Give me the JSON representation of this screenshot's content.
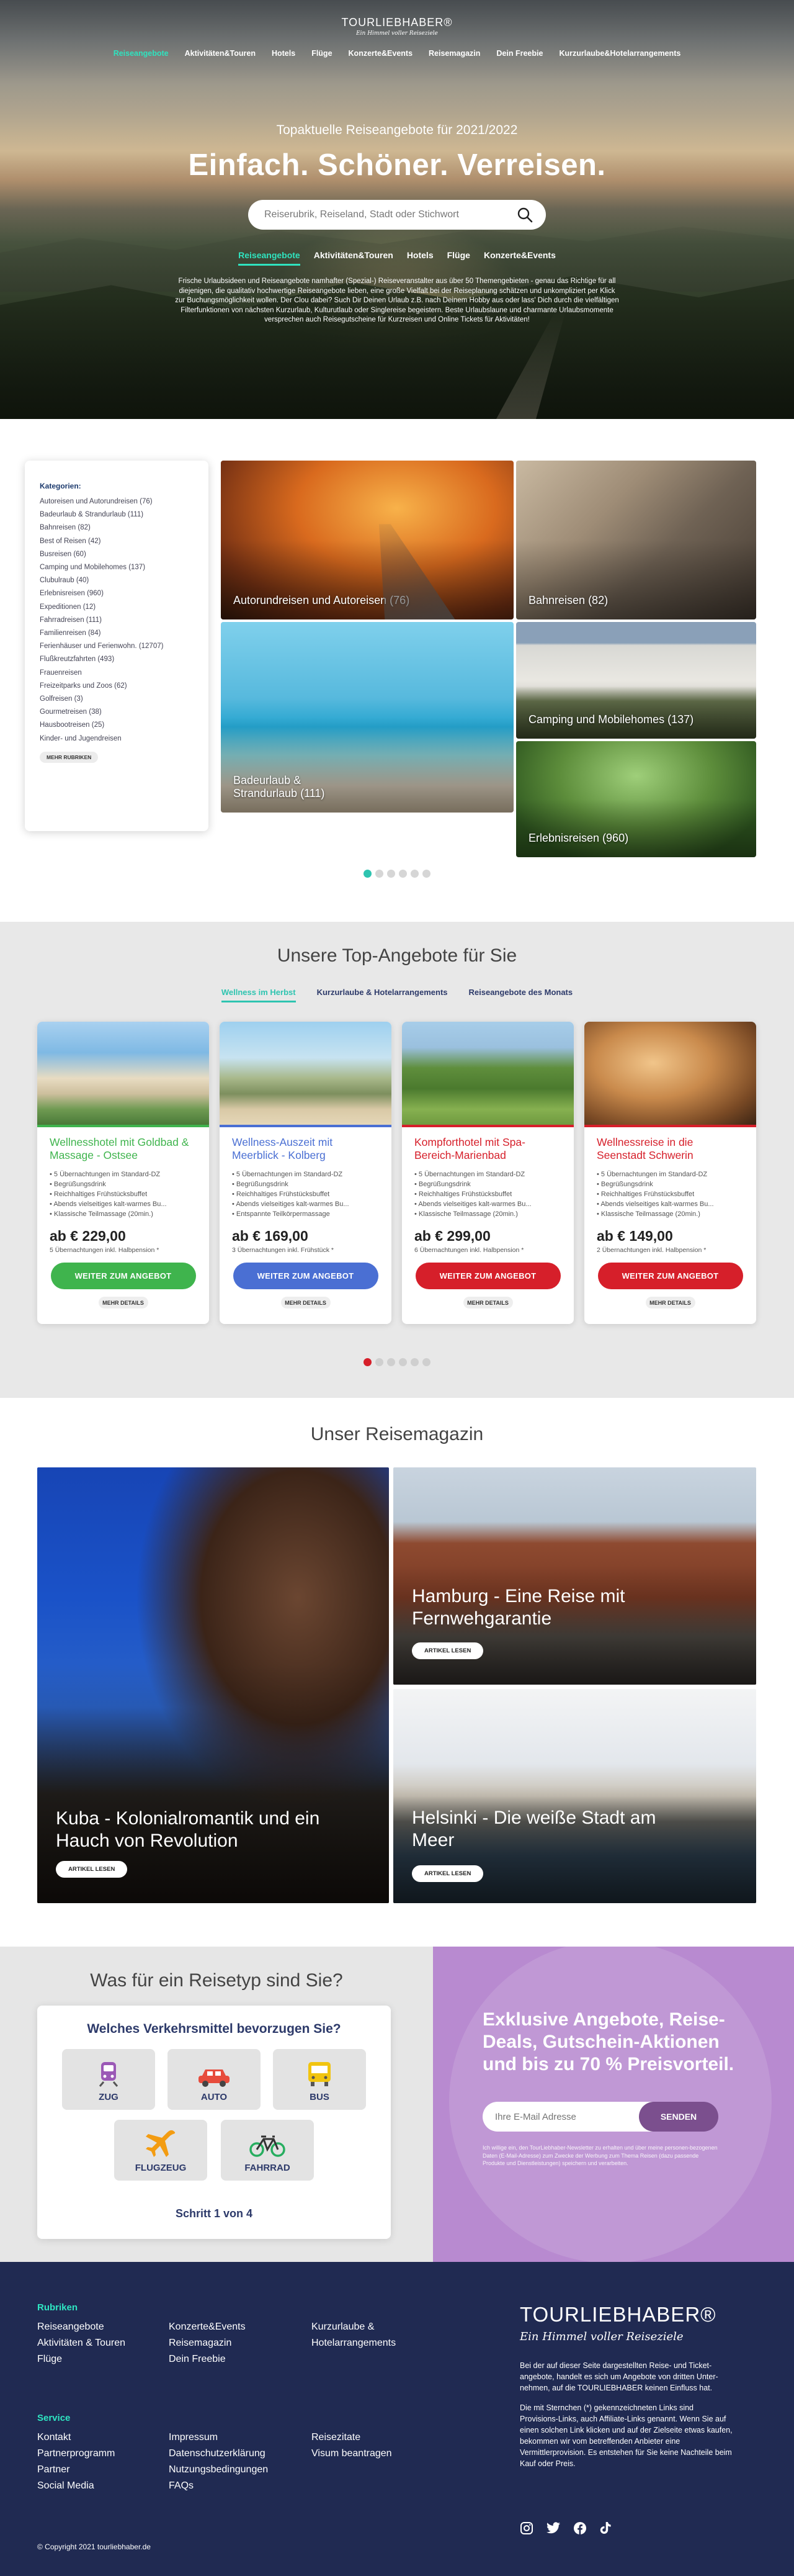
{
  "brand": {
    "name_bold": "TOUR",
    "name_light": "LIEBHABER",
    "reg": "®",
    "slogan": "Ein Himmel voller Reiseziele"
  },
  "topnav": [
    "Reiseangebote",
    "Aktivitäten&Touren",
    "Hotels",
    "Flüge",
    "Konzerte&Events",
    "Reisemagazin",
    "Dein Freebie",
    "Kurzurlaube&Hotelarrangements"
  ],
  "hero": {
    "subtitle": "Topaktuelle Reiseangebote für 2021/2022",
    "title": "Einfach. Schöner. Verreisen.",
    "search_placeholder": "Reiserubrik, Reiseland, Stadt oder Stichwort",
    "nav": [
      "Reiseangebote",
      "Aktivitäten&Touren",
      "Hotels",
      "Flüge",
      "Konzerte&Events"
    ],
    "text": "Frische Urlaubsideen und Reiseangebote namhafter (Spezial-) Reiseveranstalter aus über 50 Themengebieten - genau das Richtige für all diejenigen, die qualitativ hochwertige Reiseangebote lieben, eine große Vielfalt bei der Reiseplanung schätzen und unkompliziert per Klick zur Buchungsmöglichkeit wollen. Der Clou dabei? Such Dir Deinen Urlaub z.B. nach Deinem Hobby aus oder lass' Dich durch die vielfältigen Filterfunktionen von nächsten Kurzurlaub, Kulturutlaub oder Singlereise begeistern. Beste Urlaubslaune und charmante Urlaubsmomente versprechen auch Reisegutscheine für Kurzreisen und Online Tickets für Aktivitäten!"
  },
  "categories": {
    "heading": "Kategorien:",
    "items": [
      "Autoreisen und Autorundreisen (76)",
      "Badeurlaub & Strandurlaub (111)",
      "Bahnreisen (82)",
      "Best of Reisen (42)",
      "Busreisen (60)",
      "Camping und Mobilehomes (137)",
      "Clubulraub (40)",
      "Erlebnisreisen (960)",
      "Expeditionen (12)",
      "Fahrradreisen (111)",
      "Familienreisen (84)",
      "Ferienhäuser und Ferienwohn. (12707)",
      "Flußkreutzfahrten (493)",
      "Frauenreisen",
      "Freizeitparks und Zoos (62)",
      "Golfreisen (3)",
      "Gourmetreisen (38)",
      "Hausbootreisen (25)",
      "Kinder- und Jugendreisen"
    ],
    "more": "MEHR RUBRIKEN",
    "tiles": [
      "Autorundreisen und Autoreisen (76)",
      "Bahnreisen (82)",
      "Camping und Mobilehomes (137)",
      "Badeurlaub & Strandurlaub (111)",
      "Erlebnisreisen (960)"
    ]
  },
  "offers": {
    "title": "Unsere Top-Angebote für Sie",
    "tabs": [
      "Wellness im Herbst",
      "Kurzurlaube & Hotelarrangements",
      "Reiseangebote des Monats"
    ],
    "cards": [
      {
        "title": "Wellnesshotel mit Goldbad & Massage - Ostsee",
        "color": "#3fb44d",
        "features": [
          "5 Übernachtungen im Standard-DZ",
          "Begrüßungsdrink",
          "Reichhaltiges Frühstücksbuffet",
          "Abends vielseitiges kalt-warmes Bu...",
          "Klassische Teilmassage (20min.)"
        ],
        "price": "ab € 229,00",
        "nights": "5 Übernachtungen inkl. Halbpension *",
        "cta": "WEITER ZUM ANGEBOT",
        "details": "MEHR DETAILS"
      },
      {
        "title": "Wellness-Auszeit mit Meerblick - Kolberg",
        "color": "#4a6fd3",
        "features": [
          "5 Übernachtungen im Standard-DZ",
          "Begrüßungsdrink",
          "Reichhaltiges Frühstücksbuffet",
          "Abends vielseitiges kalt-warmes Bu...",
          "Entspannte Teilkörpermassage"
        ],
        "price": "ab € 169,00",
        "nights": "3 Übernachtungen inkl. Frühstück *",
        "cta": "WEITER ZUM ANGEBOT",
        "details": "MEHR DETAILS"
      },
      {
        "title": "Kompforthotel mit Spa-Bereich-Marienbad",
        "color": "#d61f2a",
        "features": [
          "5 Übernachtungen im Standard-DZ",
          "Begrüßungsdrink",
          "Reichhaltiges Frühstücksbuffet",
          "Abends vielseitiges kalt-warmes Bu...",
          "Klassische Teilmassage (20min.)"
        ],
        "price": "ab € 299,00",
        "nights": "6 Übernachtungen inkl. Halbpension *",
        "cta": "WEITER ZUM ANGEBOT",
        "details": "MEHR DETAILS"
      },
      {
        "title": "Wellnessreise in die Seenstadt Schwerin",
        "color": "#d61f2a",
        "features": [
          "5 Übernachtungen im Standard-DZ",
          "Begrüßungsdrink",
          "Reichhaltiges Frühstücksbuffet",
          "Abends vielseitiges kalt-warmes Bu...",
          "Klassische Teilmassage (20min.)"
        ],
        "price": "ab € 149,00",
        "nights": "2 Übernachtungen inkl. Halbpension *",
        "cta": "WEITER ZUM ANGEBOT",
        "details": "MEHR DETAILS"
      }
    ]
  },
  "magazine": {
    "title": "Unser Reisemagazin",
    "articles": [
      {
        "title": "Kuba - Kolonialromantik und ein Hauch von Revolution",
        "button": "ARTIKEL LESEN"
      },
      {
        "title": "Hamburg - Eine Reise mit Fernwehgarantie",
        "button": "ARTIKEL LESEN"
      },
      {
        "title": "Helsinki - Die weiße Stadt am Meer",
        "button": "ARTIKEL LESEN"
      }
    ]
  },
  "quiz": {
    "title": "Was für ein Reisetyp sind Sie?",
    "question": "Welches Verkehrsmittel bevorzugen Sie?",
    "options": [
      "ZUG",
      "AUTO",
      "BUS",
      "FLUGZEUG",
      "FAHRRAD"
    ],
    "step": "Schritt 1 von 4"
  },
  "newsletter": {
    "headline": "Exklusive Angebote, Reise-Deals, Gutschein-Aktionen und bis zu 70 % Preisvorteil.",
    "placeholder": "Ihre E-Mail Adresse",
    "button": "SENDEN",
    "legal": "Ich willige ein, den TourLiebhaber-Newsletter zu erhalten und über meine personen-bezogenen Daten (E-Mail-Adresse) zum Zwecke der Werbung zum Thema Reisen (dazu passende Produkte und Dienstleistungen) speichern und verarbeiten."
  },
  "footer": {
    "rubriken_title": "Rubriken",
    "rubriken_col1": [
      "Reiseangebote",
      "Aktivitäten & Touren",
      "Flüge"
    ],
    "rubriken_col2": [
      "Konzerte&Events",
      "Reisemagazin",
      "Dein Freebie"
    ],
    "rubriken_col3": [
      "Kurzurlaube &",
      "Hotelarrangements"
    ],
    "service_title": "Service",
    "service_col1": [
      "Kontakt",
      "Partnerprogramm",
      "Partner",
      "Social Media"
    ],
    "service_col2": [
      "Impressum",
      "Datenschutzerklärung",
      "Nutzungsbedingungen",
      "FAQs"
    ],
    "service_col3": [
      "Reisezitate",
      "Visum beantragen"
    ],
    "text1": "Bei der auf dieser Seite dargestellten Reise- und Ticket-angebote, handelt es sich um Angebote von dritten Unter-nehmen, auf die TOURLIEBHABER keinen Einfluss hat.",
    "text2": "Die mit Sternchen (*) gekennzeichneten Links sind Provisions-Links, auch Affiliate-Links genannt. Wenn Sie auf einen solchen Link klicken und auf der Zielseite etwas kaufen, bekommen wir vom betreffenden Anbieter eine Vermittlerprovision. Es entstehen für Sie keine Nachteile beim Kauf oder Preis.",
    "copyright": "© Copyright 2021 tourliebhaber.de"
  },
  "colors": {
    "accent": "#2ec4b0",
    "navy": "#202a52",
    "newsletter": "#b88ad0"
  }
}
